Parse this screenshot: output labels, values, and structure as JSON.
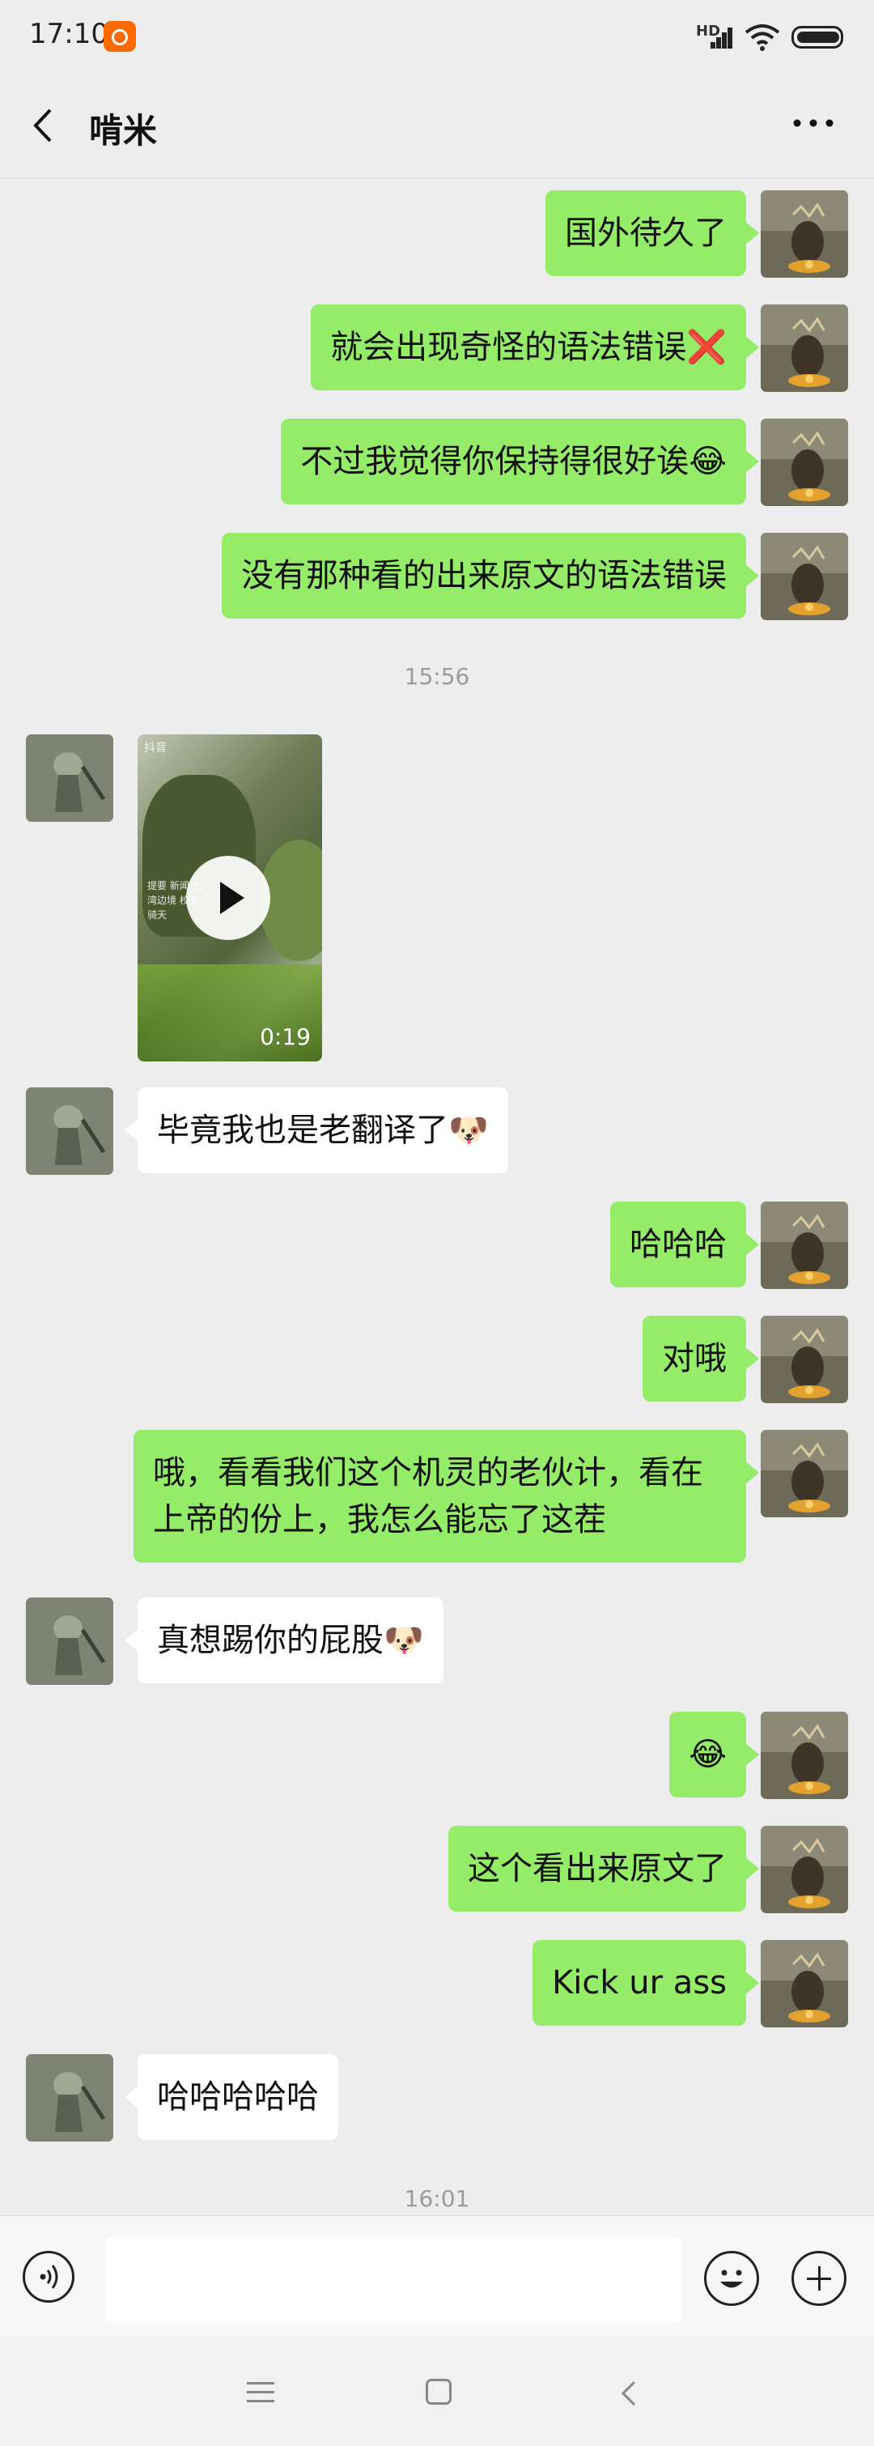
{
  "status_bar": {
    "time": "17:10",
    "network": "HD"
  },
  "header": {
    "title": "啃米"
  },
  "messages": [
    {
      "from": "me",
      "text": "国外待久了"
    },
    {
      "from": "me",
      "text": "就会出现奇怪的语法错误",
      "emoji": "❌"
    },
    {
      "from": "me",
      "text": "不过我觉得你保持得很好诶",
      "emoji": "😂"
    },
    {
      "from": "me",
      "text": "没有那种看的出来原文的语法错误"
    },
    {
      "type": "timestamp",
      "text": "15:56"
    },
    {
      "from": "them",
      "type": "video",
      "duration": "0:19",
      "watermark": "抖音",
      "caption": "提要 新闻 北湾边境 校生骑天"
    },
    {
      "from": "them",
      "text": "毕竟我也是老翻译了",
      "emoji": "🐶"
    },
    {
      "from": "me",
      "text": "哈哈哈"
    },
    {
      "from": "me",
      "text": "对哦"
    },
    {
      "from": "me",
      "text": "哦，看看我们这个机灵的老伙计，看在上帝的份上，我怎么能忘了这茬"
    },
    {
      "from": "them",
      "text": "真想踢你的屁股",
      "emoji": "🐶"
    },
    {
      "from": "me",
      "text": "",
      "emoji": "😂"
    },
    {
      "from": "me",
      "text": "这个看出来原文了"
    },
    {
      "from": "me",
      "text": "Kick ur ass"
    },
    {
      "from": "them",
      "text": "哈哈哈哈哈"
    },
    {
      "type": "timestamp",
      "text": "16:01"
    }
  ],
  "input": {
    "placeholder": ""
  },
  "icons": {
    "back": "chevron-left-icon",
    "more": "more-dots-icon",
    "voice": "voice-icon",
    "emoji": "smile-icon",
    "plus": "plus-icon",
    "nav_menu": "menu-icon",
    "nav_home": "home-icon",
    "nav_back": "back-icon",
    "play": "play-icon"
  },
  "colors": {
    "sent_bubble": "#95ec69",
    "received_bubble": "#ffffff",
    "background": "#ededed",
    "notification": "#ff6a00"
  }
}
